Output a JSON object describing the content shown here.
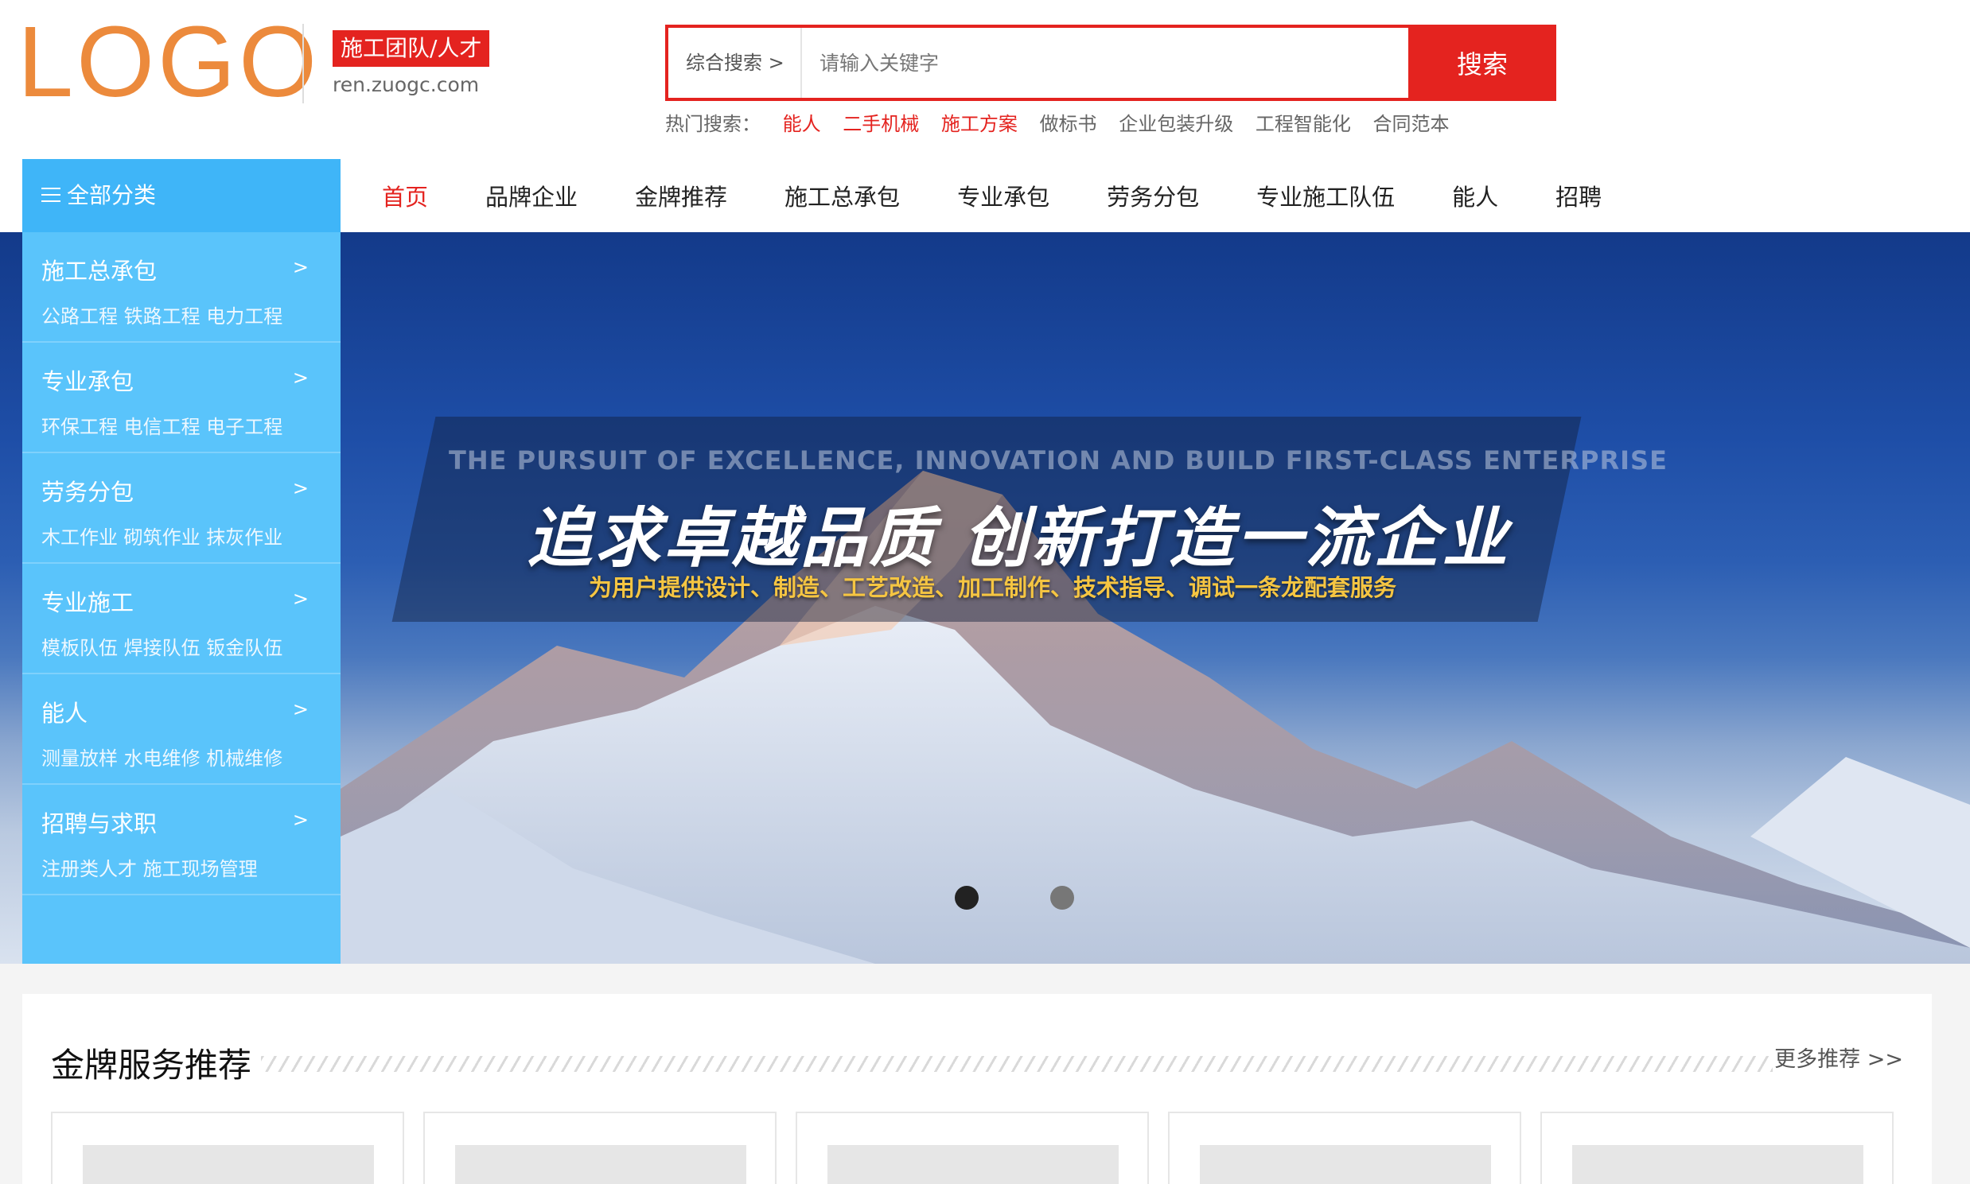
{
  "header": {
    "logo": "LOGO",
    "site_tag": "施工团队/人才",
    "site_domain": "ren.zuogc.com",
    "search": {
      "category": "综合搜索 >",
      "placeholder": "请输入关键字",
      "button": "搜索"
    },
    "hot_search": {
      "label": "热门搜索：",
      "items": [
        "能人",
        "二手机械",
        "施工方案",
        "做标书",
        "企业包装升级",
        "工程智能化",
        "合同范本"
      ],
      "highlighted_count": 3
    }
  },
  "nav": {
    "all_categories": "全部分类",
    "items": [
      "首页",
      "品牌企业",
      "金牌推荐",
      "施工总承包",
      "专业承包",
      "劳务分包",
      "专业施工队伍",
      "能人",
      "招聘"
    ],
    "active": "首页"
  },
  "sidebar": [
    {
      "title": "施工总承包",
      "sub": "公路工程 铁路工程 电力工程",
      "arrow": ">"
    },
    {
      "title": "专业承包",
      "sub": "环保工程 电信工程 电子工程",
      "arrow": ">"
    },
    {
      "title": "劳务分包",
      "sub": "木工作业 砌筑作业 抹灰作业",
      "arrow": ">"
    },
    {
      "title": "专业施工",
      "sub": "模板队伍 焊接队伍 钣金队伍",
      "arrow": ">"
    },
    {
      "title": "能人",
      "sub": "测量放样 水电维修 机械维修",
      "arrow": ">"
    },
    {
      "title": "招聘与求职",
      "sub": "注册类人才 施工现场管理",
      "arrow": ">"
    }
  ],
  "banner": {
    "slogan_en": "THE PURSUIT OF EXCELLENCE, INNOVATION AND BUILD FIRST-CLASS ENTERPRISE",
    "slogan_cn": "追求卓越品质  创新打造一流企业",
    "slogan_sub": "为用户提供设计、制造、工艺改造、加工制作、技术指导、调试一条龙配套服务",
    "slide_count": 2,
    "active_slide": 1
  },
  "recommend": {
    "title": "金牌服务推荐",
    "more": "更多推荐 >>"
  },
  "colors": {
    "brand_red": "#e4231f",
    "logo_orange": "#ec8a3c",
    "sidebar_blue": "#5ac4fb",
    "category_header_blue": "#3fb5f8"
  }
}
